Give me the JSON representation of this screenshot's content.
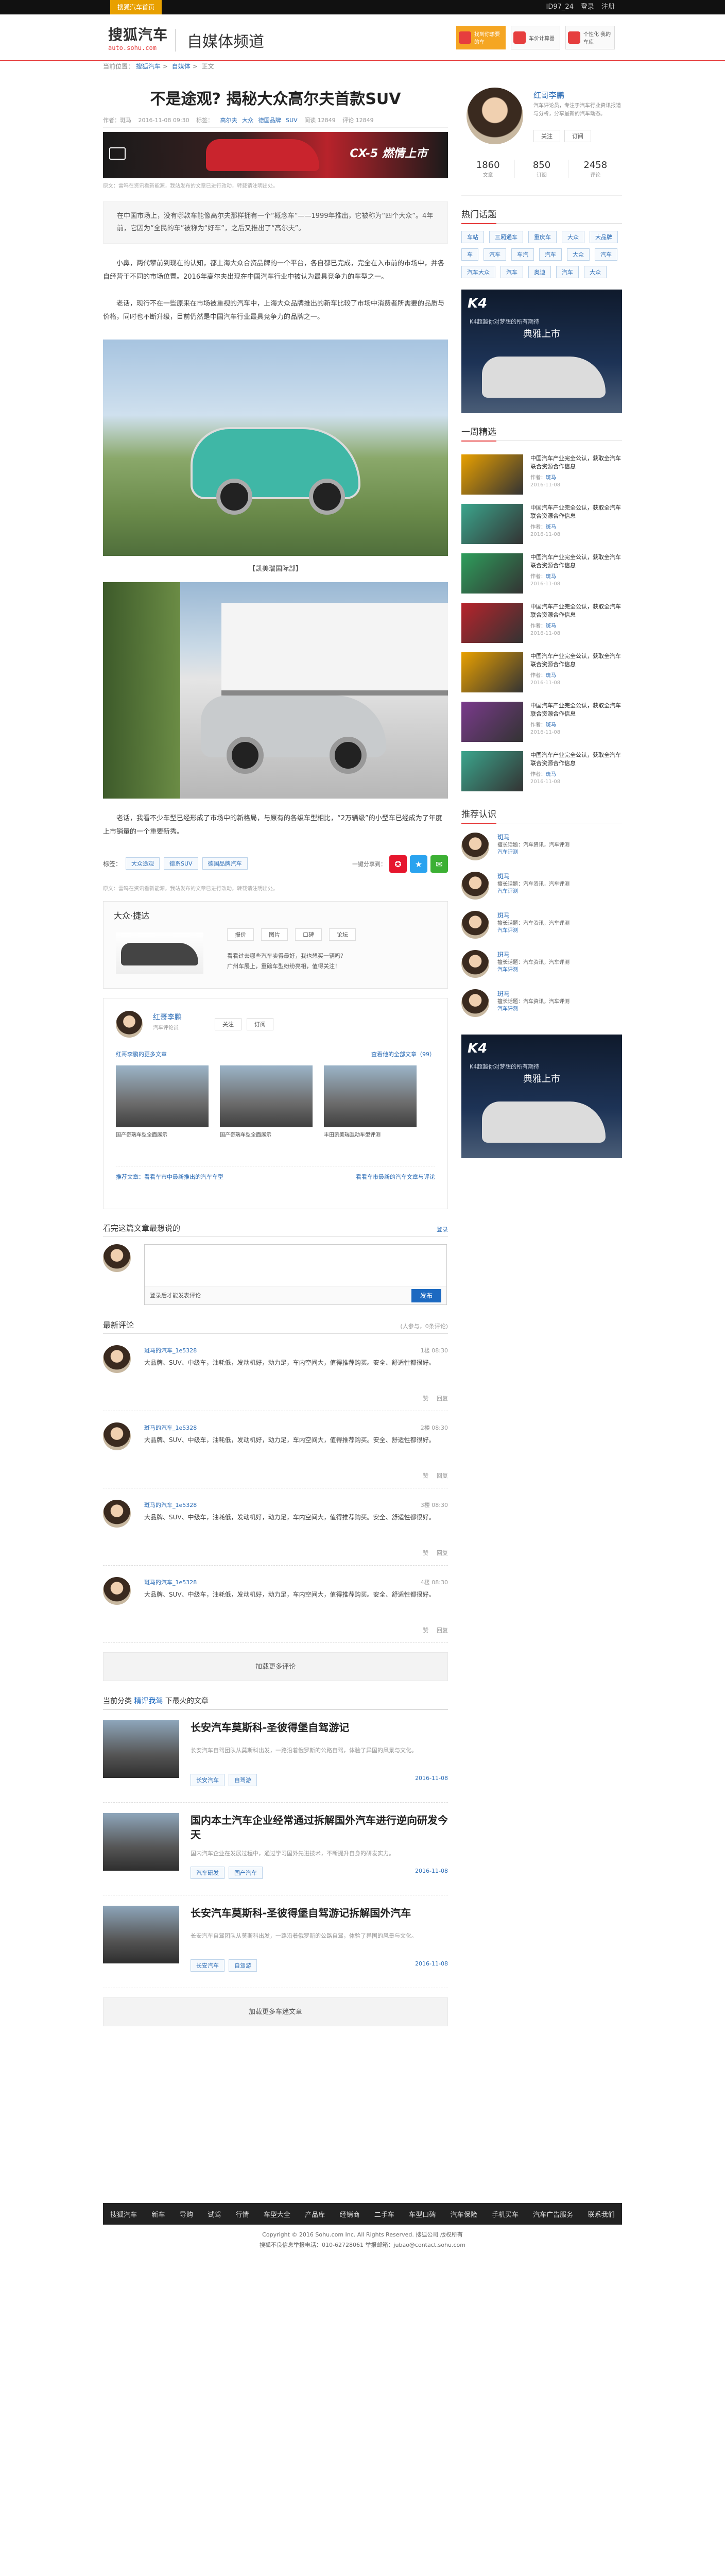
{
  "topbar": {
    "brand": "搜狐汽车首页",
    "user": "ID97_24",
    "login": "登录",
    "register": "注册"
  },
  "header": {
    "logo_main": "搜狐汽车",
    "logo_sub": "auto.sohu.com",
    "channel": "自媒体频道",
    "ads": [
      {
        "text": "找到你想要的车",
        "hot": true
      },
      {
        "text": "车价计算器"
      },
      {
        "text": "个性化 我的车库"
      }
    ]
  },
  "breadcrumb": [
    "当前位置：",
    "搜狐汽车",
    "自媒体",
    "正文"
  ],
  "article": {
    "title": "不是途观? 揭秘大众高尔夫首款SUV",
    "meta": [
      "作者：斑马",
      "2016-11-08 09:30",
      "标签：",
      "高尔夫",
      "大众",
      "德国品牌",
      "SUV",
      "阅读 12849",
      "评论 12849"
    ],
    "banner_text": "CX-5 燃情上市",
    "note": "原文：雷鸣在资讯看新能源，我站发布的文章已进行改动，转载请注明出处。",
    "summary": "在中国市场上，没有哪款车能像高尔夫那样拥有一个“概念车”——1999年推出，它被称为“四个大众”。4年前，它因为“全民的车”被称为“好车”，之后又推出了“高尔夫”。",
    "paragraph1": "小鼻，两代攀前到现在的认知，都上海大众合资品牌的一个平台，各自都已完成，完全在入市前的市场中，并各自经营于不同的市场位置。2016年高尔夫出现在中国汽车行业中被认为最具竞争力的车型之一。",
    "paragraph2": "老话，现行不在一些原来在市场被重视的汽车中，上海大众品牌推出的新车比较了市场中消费者所需要的品质与价格，同时也不断升级，目前仍然是中国汽车行业最具竞争力的品牌之一。",
    "photo1_caption": "【凯美瑞国际部】",
    "paragraph3": "老话，我看不少车型已经形成了市场中的新格局，与原有的各级车型相比，“2万辆级”的小型车已经成为了年度上市销量的一个重要新秀。",
    "tags_label": "标签：",
    "tags": [
      "大众途观",
      "德系SUV",
      "德国品牌汽车"
    ],
    "share_label": "一键分享到：",
    "copy_note": "原文：雷鸣在资讯看新能源，我站发布的文章已进行改动，转载请注明出处。"
  },
  "car_box": {
    "title": "大众·捷达",
    "buttons": [
      "报价",
      "图片",
      "口碑",
      "论坛"
    ],
    "bullets": [
      "看看过去哪些汽车卖得最好，我也想买一辆吗？",
      "广州车展上，重磅车型纷纷亮相，值得关注！"
    ]
  },
  "author_box": {
    "name": "红哥李鹏",
    "desc": "汽车评论员",
    "btn_follow": "关注",
    "btn_subscribe": "订阅",
    "link_left": "红哥李鹏的更多文章",
    "link_right": "查看他的全部文章（99）",
    "imgs": [
      "国产奇瑞车型全面展示",
      "国产奇瑞车型全面展示",
      "丰田凯美瑞混动车型评测"
    ],
    "foot_left": "推荐文章：看看车市中最新推出的汽车车型",
    "foot_right": "看看车市最新的汽车文章与评论"
  },
  "comment_editor": {
    "title": "看完这篇文章最想说的",
    "more": "登录",
    "login_text": "登录后才能发表评论",
    "send": "发布"
  },
  "comments": {
    "title": "最新评论",
    "count": "(人参与，0条评论)",
    "items": [
      {
        "who": "斑马的汽车_1e5328",
        "floor": "1楼 08:30",
        "text": "大品牌、SUV、中级车，油耗低，发动机好，动力足，车内空间大，值得推荐购买。安全、舒适性都很好。",
        "ops": [
          "赞",
          "回复"
        ]
      },
      {
        "who": "斑马的汽车_1e5328",
        "floor": "2楼 08:30",
        "text": "大品牌、SUV、中级车，油耗低，发动机好，动力足，车内空间大，值得推荐购买。安全、舒适性都很好。",
        "ops": [
          "赞",
          "回复"
        ]
      },
      {
        "who": "斑马的汽车_1e5328",
        "floor": "3楼 08:30",
        "text": "大品牌、SUV、中级车，油耗低，发动机好，动力足，车内空间大，值得推荐购买。安全、舒适性都很好。",
        "ops": [
          "赞",
          "回复"
        ]
      },
      {
        "who": "斑马的汽车_1e5328",
        "floor": "4楼 08:30",
        "text": "大品牌、SUV、中级车，油耗低，发动机好，动力足，车内空间大，值得推荐购买。安全、舒适性都很好。",
        "ops": [
          "赞",
          "回复"
        ]
      }
    ],
    "load_more": "加载更多评论"
  },
  "related": {
    "cur_label": "当前分类",
    "cur_cat": "精评我驾",
    "cur_rest": "下最火的文章",
    "items": [
      {
        "title": "长安汽车莫斯科-圣彼得堡自驾游记",
        "desc": "长安汽车自驾团队从莫斯科出发，一路沿着俄罗斯的公路自驾，体验了异国的风景与文化。",
        "tags": [
          "长安汽车",
          "自驾游"
        ],
        "date": "2016-11-08"
      },
      {
        "title": "国内本土汽车企业经常通过拆解国外汽车进行逆向研发今天",
        "desc": "国内汽车企业在发展过程中，通过学习国外先进技术，不断提升自身的研发实力。",
        "tags": [
          "汽车研发",
          "国产汽车"
        ],
        "date": "2016-11-08"
      },
      {
        "title": "长安汽车莫斯科-圣彼得堡自驾游记拆解国外汽车",
        "desc": "长安汽车自驾团队从莫斯科出发，一路沿着俄罗斯的公路自驾，体验了异国的风景与文化。",
        "tags": [
          "长安汽车",
          "自驾游"
        ],
        "date": "2016-11-08"
      }
    ],
    "load_more": "加载更多车迷文章"
  },
  "footer": {
    "nav": [
      "搜狐汽车",
      "新车",
      "导购",
      "试驾",
      "行情",
      "车型大全",
      "产品库",
      "经销商",
      "二手车",
      "车型口碑",
      "汽车保险",
      "手机买车",
      "汽车广告服务",
      "联系我们"
    ],
    "line1": "Copyright © 2016 Sohu.com Inc. All Rights Reserved. 搜狐公司 版权所有",
    "line2": "搜狐不良信息举报电话：010-62728061 举报邮箱：jubao@contact.sohu.com"
  },
  "sidebar": {
    "profile": {
      "name": "红哥李鹏",
      "desc": "汽车评论员，专注于汽车行业资讯报道与分析，分享最新的汽车动态。",
      "btn_follow": "关注",
      "btn_subscribe": "订阅",
      "stats": [
        {
          "n": "1860",
          "l": "文章"
        },
        {
          "n": "850",
          "l": "订阅"
        },
        {
          "n": "2458",
          "l": "评论"
        }
      ]
    },
    "hot_title": "热门话题",
    "hot_tags": [
      "车站",
      "三厢通车",
      "重庆车",
      "大众",
      "大品牌",
      "车",
      "汽车",
      "车汽",
      "汽车",
      "大众",
      "汽车",
      "汽车大众",
      "汽车",
      "奥迪",
      "汽车",
      "大众"
    ],
    "ad": {
      "k4": "K4",
      "line": "K4超越你对梦想的所有期待",
      "big": "典雅上市"
    },
    "week_title": "一周精选",
    "week_items": [
      {
        "title": "中国汽车产业完全公认，获取全汽车联合资源合作信息",
        "author": "斑马",
        "date": "2016-11-08",
        "color": "#e8a000"
      },
      {
        "title": "中国汽车产业完全公认，获取全汽车联合资源合作信息",
        "author": "斑马",
        "date": "2016-11-08",
        "color": "#3ba58c"
      },
      {
        "title": "中国汽车产业完全公认，获取全汽车联合资源合作信息",
        "author": "斑马",
        "date": "2016-11-08",
        "color": "#2e9e5c"
      },
      {
        "title": "中国汽车产业完全公认，获取全汽车联合资源合作信息",
        "author": "斑马",
        "date": "2016-11-08",
        "color": "#b8232b"
      },
      {
        "title": "中国汽车产业完全公认，获取全汽车联合资源合作信息",
        "author": "斑马",
        "date": "2016-11-08",
        "color": "#e8a000"
      },
      {
        "title": "中国汽车产业完全公认，获取全汽车联合资源合作信息",
        "author": "斑马",
        "date": "2016-11-08",
        "color": "#7a3a8c"
      },
      {
        "title": "中国汽车产业完全公认，获取全汽车联合资源合作信息",
        "author": "斑马",
        "date": "2016-11-08",
        "color": "#3ba58c"
      }
    ],
    "rec_title": "推荐认识",
    "rec_items": [
      {
        "name": "斑马",
        "line1": "擅长话题：汽车资讯，汽车评测",
        "line2": "汽车评测"
      },
      {
        "name": "斑马",
        "line1": "擅长话题：汽车资讯，汽车评测",
        "line2": "汽车评测"
      },
      {
        "name": "斑马",
        "line1": "擅长话题：汽车资讯，汽车评测",
        "line2": "汽车评测"
      },
      {
        "name": "斑马",
        "line1": "擅长话题：汽车资讯，汽车评测",
        "line2": "汽车评测"
      },
      {
        "name": "斑马",
        "line1": "擅长话题：汽车资讯，汽车评测",
        "line2": "汽车评测"
      }
    ],
    "ad2": {
      "k4": "K4",
      "line": "K4超越你对梦想的所有期待",
      "big": "典雅上市"
    }
  }
}
